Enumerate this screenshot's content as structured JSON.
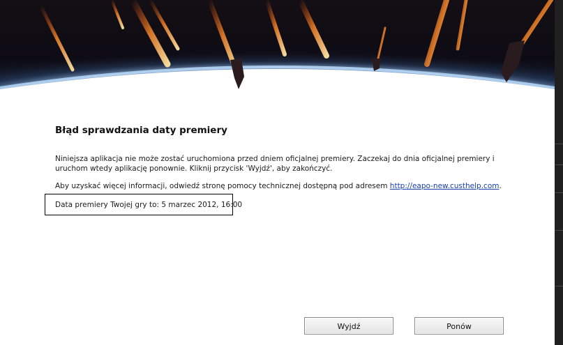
{
  "dialog": {
    "title": "Błąd sprawdzania daty premiery",
    "message": "Niniejsza aplikacja nie może zostać uruchomiona przed dniem oficjalnej premiery. Zaczekaj do dnia oficjalnej premiery i uruchom wtedy aplikację ponownie. Kliknij przycisk 'Wyjdź', aby zakończyć.",
    "info_prefix": "Aby uzyskać więcej informacji, odwiedź stronę pomocy technicznej dostępną pod adresem",
    "info_link": "http://eapo-new.custhelp.com",
    "info_suffix": ".",
    "release_date_label": "Data premiery Twojej gry to: 5 marzec 2012, 16:00"
  },
  "buttons": {
    "exit_label": "Wyjdź",
    "retry_label": "Ponów"
  },
  "banner": {
    "image": "space-planet-horizon-with-fiery-meteors",
    "colors": {
      "space": "#0c0a12",
      "atmosphere": "#cfe6ff",
      "fire": "#ff8a2a"
    }
  }
}
